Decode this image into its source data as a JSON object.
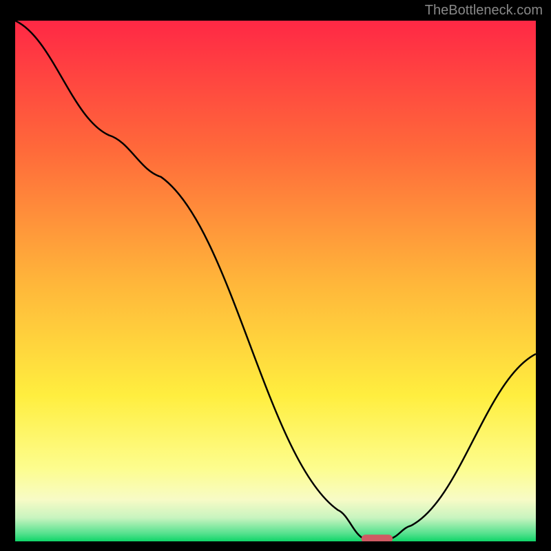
{
  "watermark": "TheBottleneck.com",
  "chart_data": {
    "type": "line",
    "title": "",
    "xlabel": "",
    "ylabel": "",
    "xlim": [
      0,
      100
    ],
    "ylim": [
      0,
      100
    ],
    "grid": false,
    "series": [
      {
        "name": "curve",
        "x": [
          0,
          18,
          28,
          62,
          67,
          72,
          76,
          100
        ],
        "y": [
          100,
          78,
          70,
          6,
          0.5,
          0.5,
          3,
          36
        ]
      }
    ],
    "marker": {
      "x": 69.5,
      "y": 0.5,
      "width": 6,
      "height": 2,
      "color": "#cf5b63"
    },
    "gradient_stops": [
      {
        "offset": 0.0,
        "color": "#ff2845"
      },
      {
        "offset": 0.25,
        "color": "#ff6a3a"
      },
      {
        "offset": 0.5,
        "color": "#ffb53a"
      },
      {
        "offset": 0.72,
        "color": "#ffee3f"
      },
      {
        "offset": 0.86,
        "color": "#fdfd8e"
      },
      {
        "offset": 0.92,
        "color": "#f7fbc6"
      },
      {
        "offset": 0.955,
        "color": "#c8f4bf"
      },
      {
        "offset": 0.985,
        "color": "#55e18e"
      },
      {
        "offset": 1.0,
        "color": "#0fd568"
      }
    ]
  }
}
